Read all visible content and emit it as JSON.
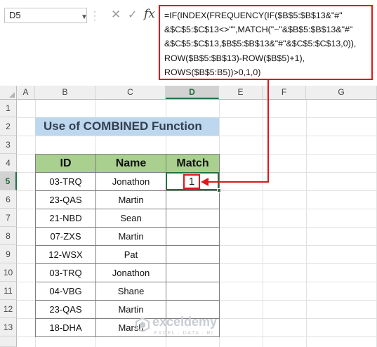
{
  "formula_bar": {
    "name_box": "D5",
    "fx_label": "fx",
    "formula_lines": [
      "=IF(INDEX(FREQUENCY(IF($B$5:$B$13&\"#\"",
      "&$C$5:$C$13<>\"\",MATCH(\"~\"&$B$5:$B$13&\"#\"",
      "&$C$5:$C$13,$B$5:$B$13&\"#\"&$C$5:$C$13,0)),",
      "ROW($B$5:$B$13)-ROW($B$5)+1),",
      "ROWS($B$5:B5))>0,1,0)"
    ]
  },
  "columns": [
    "A",
    "B",
    "C",
    "D",
    "E",
    "F",
    "G"
  ],
  "selected_column": "D",
  "rows": [
    "1",
    "2",
    "3",
    "4",
    "5",
    "6",
    "7",
    "8",
    "9",
    "10",
    "11",
    "12",
    "13"
  ],
  "selected_row": "5",
  "title": "Use of COMBINED Function",
  "table": {
    "headers": [
      "ID",
      "Name",
      "Match"
    ],
    "rows": [
      [
        "03-TRQ",
        "Jonathon",
        "1"
      ],
      [
        "23-QAS",
        "Martin",
        ""
      ],
      [
        "21-NBD",
        "Sean",
        ""
      ],
      [
        "07-ZXS",
        "Martin",
        ""
      ],
      [
        "12-WSX",
        "Pat",
        ""
      ],
      [
        "03-TRQ",
        "Jonathon",
        ""
      ],
      [
        "04-VBG",
        "Shane",
        ""
      ],
      [
        "23-QAS",
        "Martin",
        ""
      ],
      [
        "18-DHA",
        "Marsh",
        ""
      ]
    ]
  },
  "watermark": {
    "name": "exceldemy",
    "tagline": "EXCEL · DATA · BI"
  },
  "colors": {
    "highlight_red": "#e0161b",
    "header_green": "#a9d08e",
    "title_blue": "#bdd7ee",
    "selection_green": "#217346"
  }
}
